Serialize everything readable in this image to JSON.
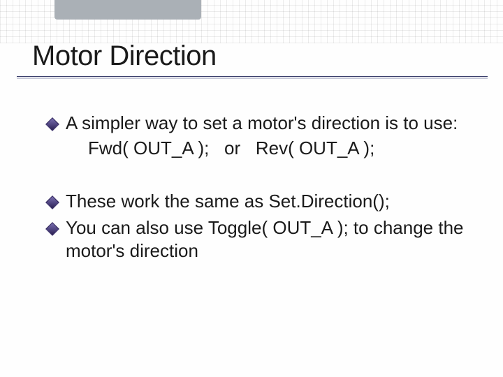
{
  "title": "Motor Direction",
  "bullets": {
    "b1_text": "A simpler way to set a motor's direction is to use:",
    "b1_code_a": "Fwd( OUT_A );",
    "b1_code_sep": "or",
    "b1_code_b": "Rev( OUT_A );",
    "b2_text": "These work the same as Set.Direction();",
    "b3_pre": "You can also use ",
    "b3_code": "Toggle( OUT_A );",
    "b3_post": " to change the motor's direction"
  }
}
